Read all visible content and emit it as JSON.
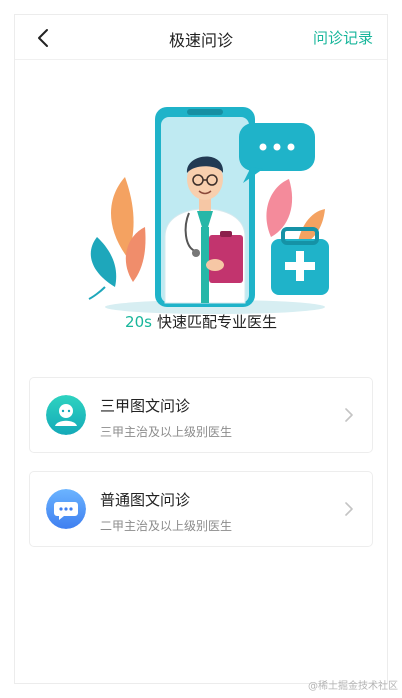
{
  "header": {
    "back_icon": "chevron-left-icon",
    "title": "极速问诊",
    "history_link": "问诊记录"
  },
  "hero": {
    "tagline_highlight": "20s",
    "tagline_rest": "快速匹配专业医生"
  },
  "options": [
    {
      "title": "三甲图文问诊",
      "subtitle": "三甲主治及以上级别医生",
      "icon": "doctor-avatar-icon",
      "arrow": "chevron-right-icon"
    },
    {
      "title": "普通图文问诊",
      "subtitle": "二甲主治及以上级别医生",
      "icon": "chat-bubble-icon",
      "arrow": "chevron-right-icon"
    }
  ],
  "watermark": "@稀土掘金技术社区",
  "colors": {
    "accent": "#18b69b",
    "teal": "#1fb3c9",
    "blue": "#4f8ff7"
  }
}
